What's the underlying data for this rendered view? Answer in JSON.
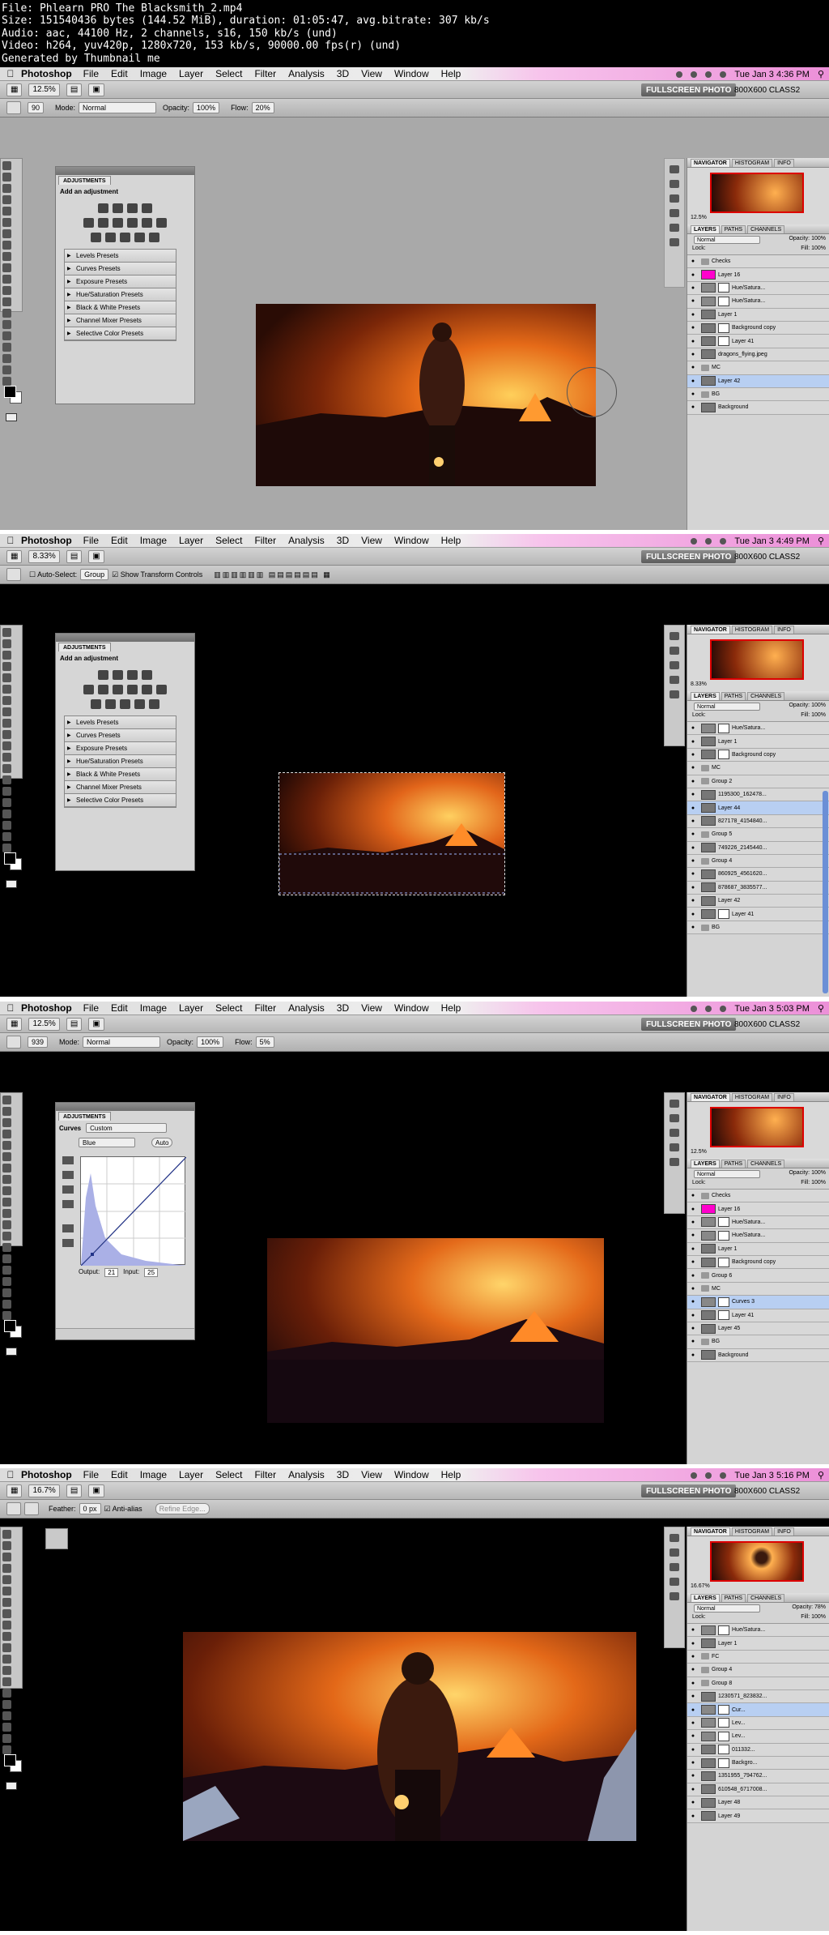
{
  "header": {
    "file": "File: Phlearn PRO The Blacksmith_2.mp4",
    "size": "Size: 151540436 bytes (144.52 MiB), duration: 01:05:47, avg.bitrate: 307 kb/s",
    "audio": "Audio: aac, 44100 Hz, 2 channels, s16, 150 kb/s (und)",
    "video": "Video: h264, yuv420p, 1280x720, 153 kb/s, 90000.00 fps(r) (und)",
    "generated": "Generated by Thumbnail me"
  },
  "menubar": {
    "app": "Photoshop",
    "items": [
      "File",
      "Edit",
      "Image",
      "Layer",
      "Select",
      "Filter",
      "Analysis",
      "3D",
      "View",
      "Window",
      "Help"
    ]
  },
  "appbar": {
    "fullscreen": "FULLSCREEN PHOTO",
    "workspace": "800X600 CLASS2"
  },
  "frames": [
    {
      "time": "Tue Jan 3  4:36 PM",
      "zoom": "12.5%",
      "options": {
        "brush_size": "90",
        "mode_label": "Mode:",
        "mode": "Normal",
        "opacity_label": "Opacity:",
        "opacity": "100%",
        "flow_label": "Flow:",
        "flow": "20%"
      },
      "adjustments": {
        "tab": "ADJUSTMENTS",
        "subtitle": "Add an adjustment",
        "presets": [
          "Levels Presets",
          "Curves Presets",
          "Exposure Presets",
          "Hue/Saturation Presets",
          "Black & White Presets",
          "Channel Mixer Presets",
          "Selective Color Presets"
        ]
      },
      "nav_zoom": "12.5%",
      "layers_mode": "Normal",
      "layers_opacity_label": "Opacity:",
      "layers_opacity": "100%",
      "lock_label": "Lock:",
      "fill_label": "Fill:",
      "layers_fill": "100%",
      "layers": [
        {
          "name": "Checks",
          "kind": "group"
        },
        {
          "name": "Layer 16",
          "kind": "magenta"
        },
        {
          "name": "Hue/Satura...",
          "kind": "adj"
        },
        {
          "name": "Hue/Satura...",
          "kind": "adj"
        },
        {
          "name": "Layer 1",
          "kind": "layer"
        },
        {
          "name": "Background copy",
          "kind": "masked"
        },
        {
          "name": "Layer 41",
          "kind": "masked"
        },
        {
          "name": "dragons_flying.jpeg",
          "kind": "layer"
        },
        {
          "name": "MC",
          "kind": "group"
        },
        {
          "name": "Layer 42",
          "kind": "layer",
          "selected": true
        },
        {
          "name": "BG",
          "kind": "group"
        },
        {
          "name": "Background",
          "kind": "layer"
        }
      ]
    },
    {
      "time": "Tue Jan 3  4:49 PM",
      "zoom": "8.33%",
      "options": {
        "auto_select": "Auto-Select:",
        "group": "Group",
        "transform": "Show Transform Controls"
      },
      "adjustments": {
        "tab": "ADJUSTMENTS",
        "subtitle": "Add an adjustment",
        "presets": [
          "Levels Presets",
          "Curves Presets",
          "Exposure Presets",
          "Hue/Saturation Presets",
          "Black & White Presets",
          "Channel Mixer Presets",
          "Selective Color Presets"
        ]
      },
      "nav_zoom": "8.33%",
      "layers_mode": "Normal",
      "layers_opacity_label": "Opacity:",
      "layers_opacity": "100%",
      "lock_label": "Lock:",
      "fill_label": "Fill:",
      "layers_fill": "100%",
      "layers": [
        {
          "name": "Hue/Satura...",
          "kind": "adj"
        },
        {
          "name": "Layer 1",
          "kind": "layer"
        },
        {
          "name": "Background copy",
          "kind": "masked"
        },
        {
          "name": "MC",
          "kind": "group"
        },
        {
          "name": "Group 2",
          "kind": "group"
        },
        {
          "name": "1195300_162478...",
          "kind": "layer"
        },
        {
          "name": "Layer 44",
          "kind": "layer",
          "selected": true
        },
        {
          "name": "827178_4154840...",
          "kind": "layer"
        },
        {
          "name": "Group 5",
          "kind": "group"
        },
        {
          "name": "749226_2145440...",
          "kind": "layer"
        },
        {
          "name": "Group 4",
          "kind": "group"
        },
        {
          "name": "860925_4561620...",
          "kind": "layer"
        },
        {
          "name": "878687_3835577...",
          "kind": "layer"
        },
        {
          "name": "Layer 42",
          "kind": "layer"
        },
        {
          "name": "Layer 41",
          "kind": "masked"
        },
        {
          "name": "BG",
          "kind": "group"
        }
      ]
    },
    {
      "time": "Tue Jan 3  5:03 PM",
      "zoom": "12.5%",
      "options": {
        "brush_size": "939",
        "mode_label": "Mode:",
        "mode": "Normal",
        "opacity_label": "Opacity:",
        "opacity": "100%",
        "flow_label": "Flow:",
        "flow": "5%"
      },
      "curves": {
        "tab": "ADJUSTMENTS",
        "title": "Curves",
        "preset": "Custom",
        "channel": "Blue",
        "auto": "Auto",
        "output_label": "Output:",
        "output": "21",
        "input_label": "Input:",
        "input": "25"
      },
      "nav_zoom": "12.5%",
      "layers_mode": "Normal",
      "layers_opacity_label": "Opacity:",
      "layers_opacity": "100%",
      "lock_label": "Lock:",
      "fill_label": "Fill:",
      "layers_fill": "100%",
      "layers": [
        {
          "name": "Checks",
          "kind": "group"
        },
        {
          "name": "Layer 16",
          "kind": "magenta"
        },
        {
          "name": "Hue/Satura...",
          "kind": "adj"
        },
        {
          "name": "Hue/Satura...",
          "kind": "adj"
        },
        {
          "name": "Layer 1",
          "kind": "layer"
        },
        {
          "name": "Background copy",
          "kind": "masked"
        },
        {
          "name": "Group 6",
          "kind": "group"
        },
        {
          "name": "MC",
          "kind": "group"
        },
        {
          "name": "Curves 3",
          "kind": "adj",
          "selected": true
        },
        {
          "name": "Layer 41",
          "kind": "masked"
        },
        {
          "name": "Layer 45",
          "kind": "layer"
        },
        {
          "name": "BG",
          "kind": "group"
        },
        {
          "name": "Background",
          "kind": "layer"
        }
      ]
    },
    {
      "time": "Tue Jan 3  5:16 PM",
      "zoom": "16.7%",
      "options": {
        "feather_label": "Feather:",
        "feather": "0 px",
        "anti_alias": "Anti-alias",
        "refine": "Refine Edge..."
      },
      "nav_zoom": "16.67%",
      "layers_mode": "Normal",
      "layers_opacity_label": "Opacity:",
      "layers_opacity": "78%",
      "lock_label": "Lock:",
      "fill_label": "Fill:",
      "layers_fill": "100%",
      "layers": [
        {
          "name": "Hue/Satura...",
          "kind": "adj"
        },
        {
          "name": "Layer 1",
          "kind": "layer"
        },
        {
          "name": "FC",
          "kind": "group"
        },
        {
          "name": "Group 4",
          "kind": "group"
        },
        {
          "name": "Group 8",
          "kind": "group"
        },
        {
          "name": "1230571_823832...",
          "kind": "layer"
        },
        {
          "name": "Cur...",
          "kind": "adj",
          "selected": true
        },
        {
          "name": "Lev...",
          "kind": "adj"
        },
        {
          "name": "Lev...",
          "kind": "adj"
        },
        {
          "name": "011332...",
          "kind": "masked"
        },
        {
          "name": "Backgro...",
          "kind": "masked"
        },
        {
          "name": "1351955_794762...",
          "kind": "layer"
        },
        {
          "name": "610548_6717008...",
          "kind": "layer"
        },
        {
          "name": "Layer 48",
          "kind": "layer"
        },
        {
          "name": "Layer 49",
          "kind": "layer"
        }
      ]
    }
  ]
}
